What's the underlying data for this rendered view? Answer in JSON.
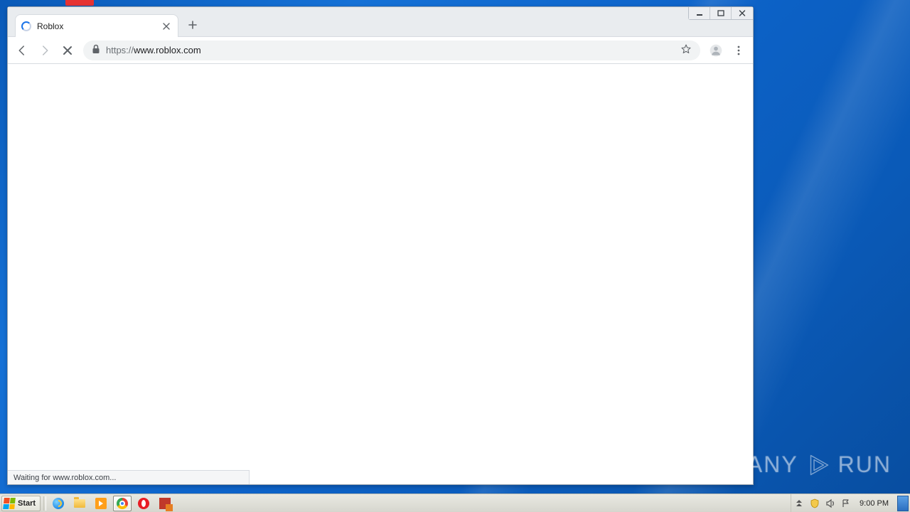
{
  "browser": {
    "tab": {
      "title": "Roblox"
    },
    "address": {
      "scheme": "https://",
      "host": "www.roblox.com",
      "path": ""
    },
    "status_text": "Waiting for www.roblox.com..."
  },
  "watermark": {
    "left": "ANY",
    "right": "RUN"
  },
  "taskbar": {
    "start_label": "Start",
    "clock": "9:00 PM"
  }
}
